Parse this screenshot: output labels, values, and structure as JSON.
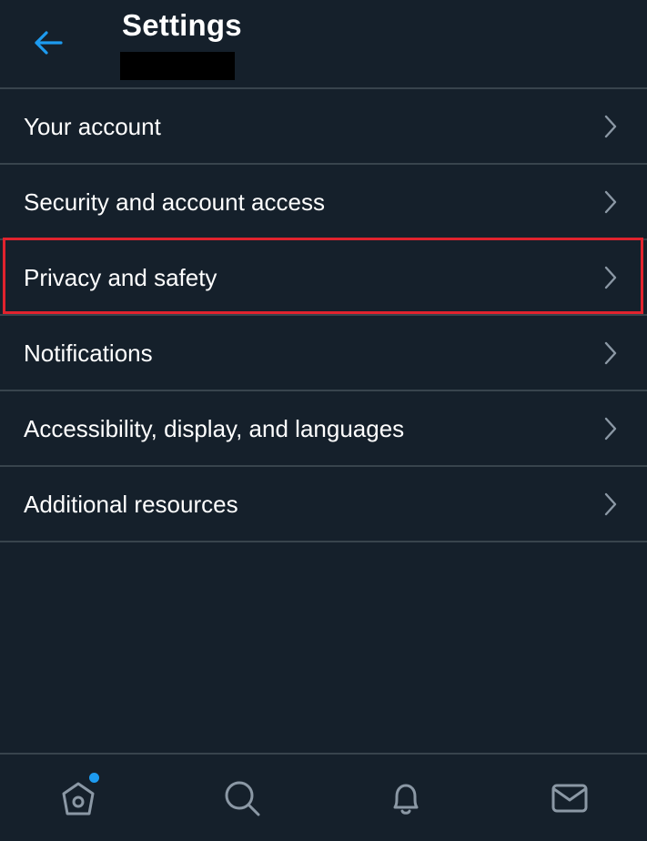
{
  "header": {
    "title": "Settings",
    "back_icon": "arrow-left-icon"
  },
  "colors": {
    "background": "#15202b",
    "divider": "#38444d",
    "accent": "#1d9bf0",
    "highlight": "#e0232e",
    "icon": "#8b98a5"
  },
  "menu": {
    "items": [
      {
        "label": "Your account"
      },
      {
        "label": "Security and account access"
      },
      {
        "label": "Privacy and safety"
      },
      {
        "label": "Notifications"
      },
      {
        "label": "Accessibility, display, and languages"
      },
      {
        "label": "Additional resources"
      }
    ],
    "highlighted_item": "Privacy and safety"
  },
  "bottom_nav": {
    "items": [
      {
        "icon": "home-icon",
        "notification_dot": true
      },
      {
        "icon": "search-icon"
      },
      {
        "icon": "bell-icon"
      },
      {
        "icon": "mail-icon"
      }
    ]
  }
}
